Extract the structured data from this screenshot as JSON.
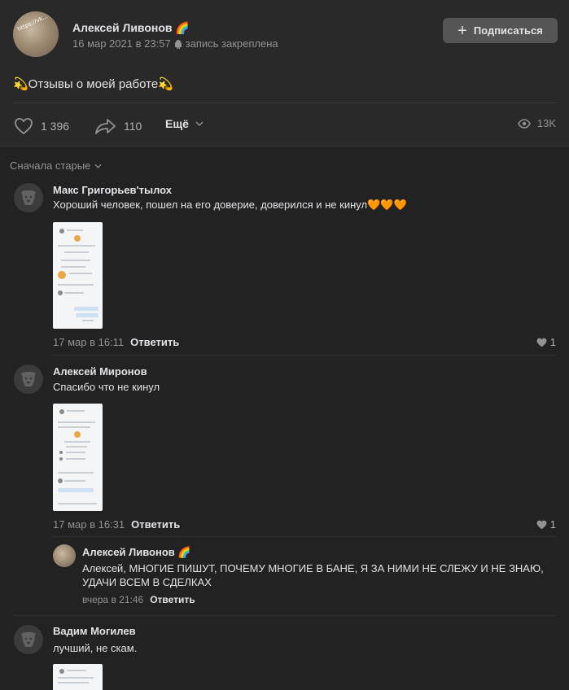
{
  "post": {
    "author": "Алексей Ливонов",
    "author_badge": "🌈",
    "date": "16 мар 2021 в 23:57",
    "pinned_note": "запись закреплена",
    "subscribe_label": "Подписаться",
    "text": "💫Отзывы о моей работе💫",
    "likes": "1 396",
    "shares": "110",
    "more_label": "Ещё",
    "views": "13K",
    "avatar_watermark": "https://vk.com/@arandlivonov"
  },
  "sort_label": "Сначала старые",
  "comments": [
    {
      "name": "Макс Григорьев'тылох",
      "text": "Хороший человек, пошел на его доверие, доверился и не кинул🧡🧡🧡",
      "date": "17 мар в 16:11",
      "reply_label": "Ответить",
      "likes": "1"
    },
    {
      "name": "Алексей Миронов",
      "text": "Спасибо что не кинул",
      "date": "17 мар в 16:31",
      "reply_label": "Ответить",
      "likes": "1"
    },
    {
      "name": "Вадим Могилев",
      "text": "лучший, не скам."
    }
  ],
  "reply": {
    "name": "Алексей Ливонов",
    "badge": "🌈",
    "text": "Алексей, МНОГИЕ ПИШУТ, ПОЧЕМУ МНОГИЕ В БАНЕ, Я ЗА НИМИ НЕ СЛЕЖУ И НЕ ЗНАЮ, УДАЧИ ВСЕМ В СДЕЛКАХ",
    "date": "вчера в 21:46",
    "reply_label": "Ответить"
  },
  "colors": {
    "background": "#222222",
    "card": "#292929",
    "text_primary": "#e1e3e6",
    "text_secondary": "#939393",
    "button_bg": "#555555"
  }
}
